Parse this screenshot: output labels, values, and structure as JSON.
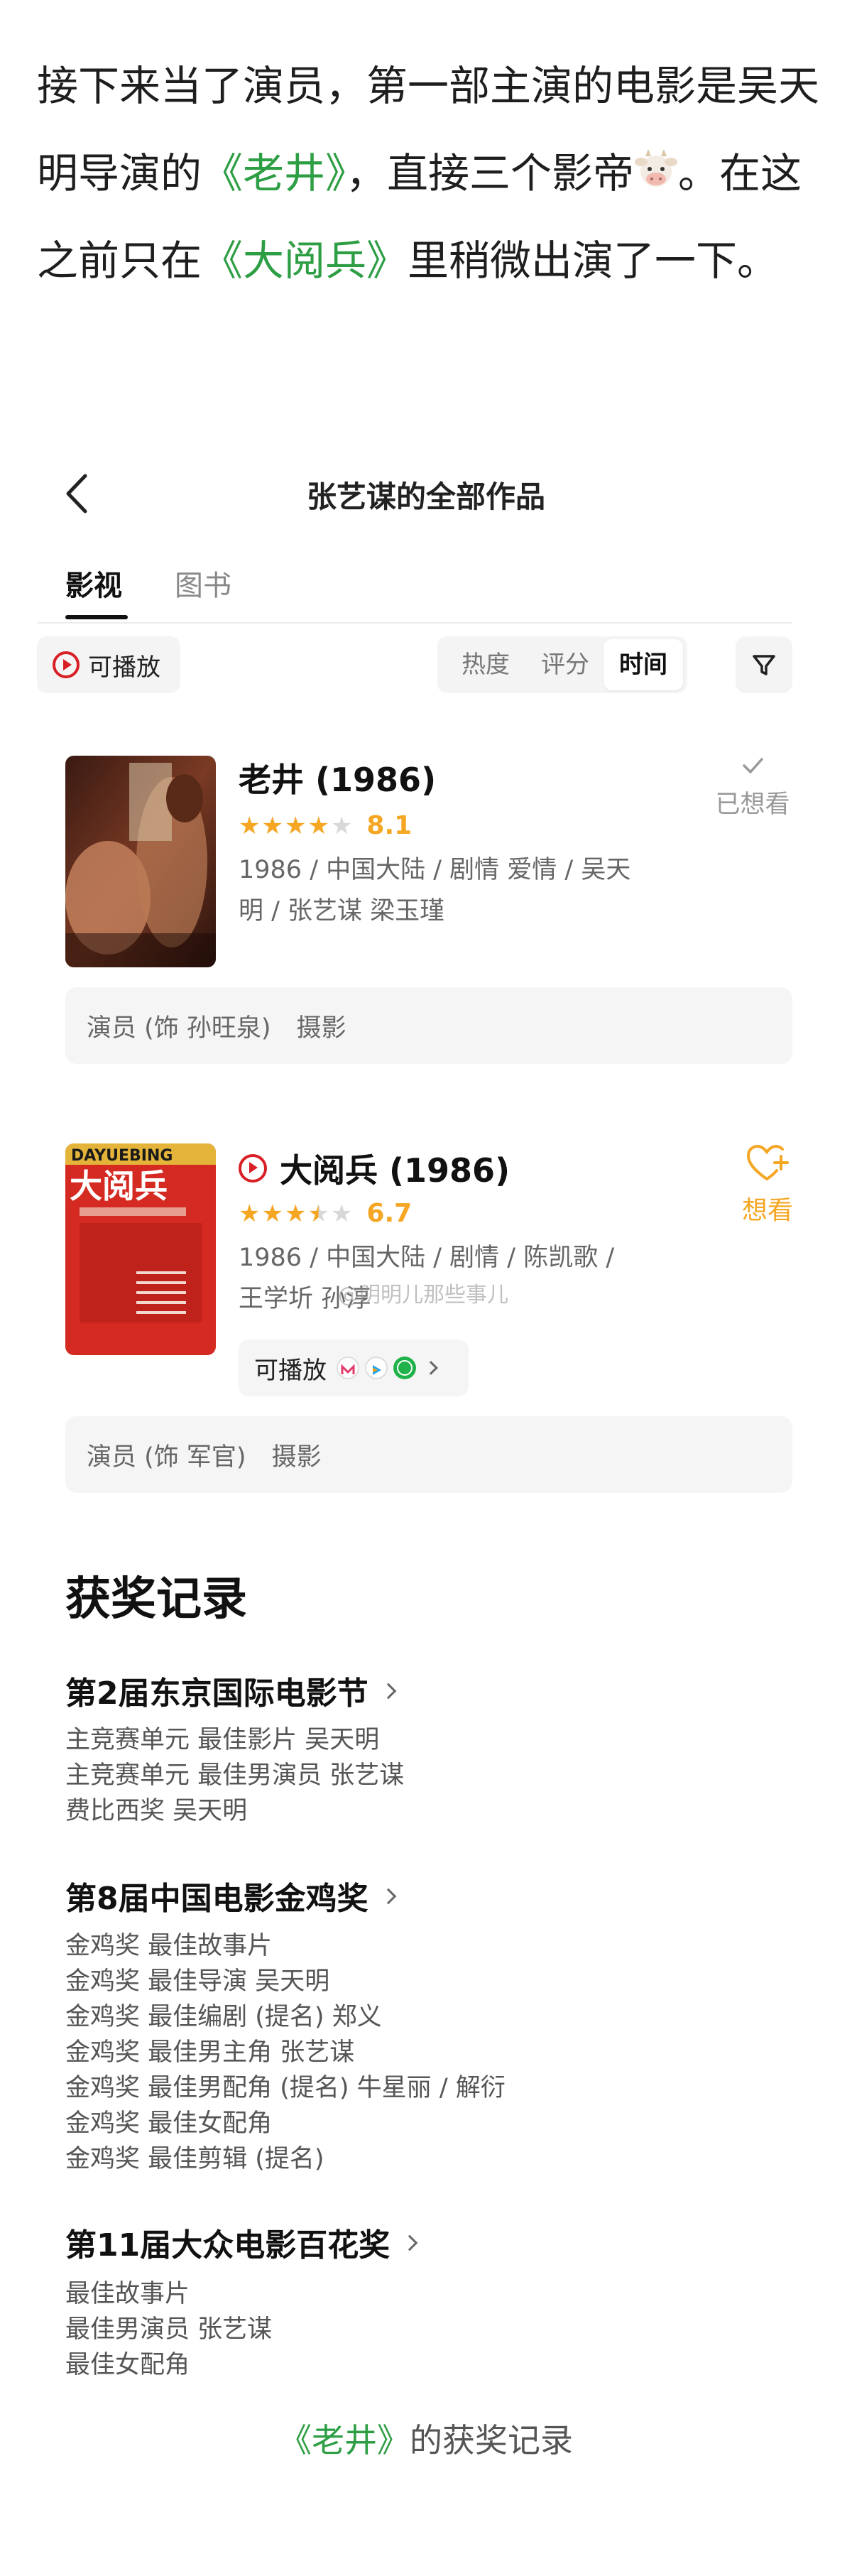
{
  "intro": {
    "part1": "接下来当了演员，第一部主演的电影是吴天明导演的",
    "film1": "《老井》",
    "part2": "，直接三个影帝",
    "part3": "。在这之前只在",
    "film2": "《大阅兵》",
    "part4": "里稍微出演了一下。"
  },
  "header": {
    "title": "张艺谋的全部作品"
  },
  "tabs": [
    {
      "label": "影视"
    },
    {
      "label": "图书"
    }
  ],
  "filters": {
    "playable": "可播放",
    "sort": [
      "热度",
      "评分",
      "时间"
    ]
  },
  "films": [
    {
      "title": "老井 (1986)",
      "rating": 8.1,
      "stars": 4,
      "score": "8.1",
      "meta": "1986 / 中国大陆 / 剧情 爱情 / 吴天明 / 张艺谋 梁玉瑾",
      "status": "已想看",
      "role": "演员 (饰 孙旺泉)",
      "role2": "摄影"
    },
    {
      "title": "大阅兵 (1986)",
      "rating": 6.7,
      "stars": 3.5,
      "score": "6.7",
      "meta": "1986 / 中国大陆 / 剧情 / 陈凯歌 / 王学圻 孙淳",
      "status": "想看",
      "play_label": "可播放",
      "poster_text": "DAYUEBING",
      "poster_title": "大阅兵",
      "role": "演员 (饰 军官)",
      "role2": "摄影"
    }
  ],
  "watermark": "@明明儿那些事儿",
  "awards": {
    "title": "获奖记录",
    "groups": [
      {
        "name": "第2届东京国际电影节",
        "items": [
          "主竞赛单元 最佳影片 吴天明",
          "主竞赛单元 最佳男演员 张艺谋",
          "费比西奖 吴天明"
        ]
      },
      {
        "name": "第8届中国电影金鸡奖",
        "items": [
          "金鸡奖 最佳故事片",
          "金鸡奖 最佳导演 吴天明",
          "金鸡奖 最佳编剧 (提名) 郑义",
          "金鸡奖 最佳男主角 张艺谋",
          "金鸡奖 最佳男配角 (提名) 牛星丽 / 解衍",
          "金鸡奖 最佳女配角",
          "金鸡奖 最佳剪辑 (提名)"
        ]
      },
      {
        "name": "第11届大众电影百花奖",
        "items": [
          "最佳故事片",
          "最佳男演员 张艺谋",
          "最佳女配角"
        ]
      }
    ]
  },
  "caption": {
    "film": "《老井》",
    "text": "的获奖记录"
  },
  "colors": {
    "highlight_green": "#2e9e45",
    "star_orange": "#f5a623",
    "play_red": "#d91f26"
  }
}
